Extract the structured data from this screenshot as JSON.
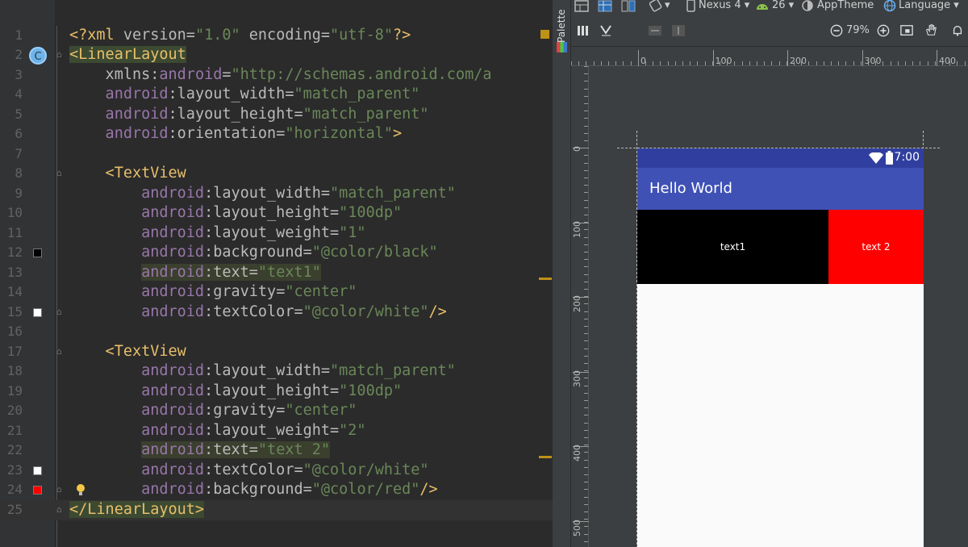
{
  "editor": {
    "lines": [
      {
        "n": "1",
        "segs": [
          [
            "g-tag",
            "<?xml "
          ],
          [
            "g-plain",
            "version"
          ],
          [
            "g-plain",
            "="
          ],
          [
            "g-str",
            "\"1.0\""
          ],
          [
            "g-plain",
            " encoding"
          ],
          [
            "g-plain",
            "="
          ],
          [
            "g-str",
            "\"utf-8\""
          ],
          [
            "g-tag",
            "?>"
          ]
        ]
      },
      {
        "n": "2",
        "segs": [
          [
            "g-tag g-hl2",
            "<LinearLayout"
          ]
        ]
      },
      {
        "n": "3",
        "segs": [
          [
            "g-plain",
            "    xmlns"
          ],
          [
            "g-plain",
            ":"
          ],
          [
            "g-attr",
            "android"
          ],
          [
            "g-plain",
            "="
          ],
          [
            "g-str",
            "\"http://schemas.android.com/a"
          ]
        ]
      },
      {
        "n": "4",
        "segs": [
          [
            "g-attr",
            "    android"
          ],
          [
            "g-plain",
            ":layout_width"
          ],
          [
            "g-plain",
            "="
          ],
          [
            "g-str",
            "\"match_parent\""
          ]
        ]
      },
      {
        "n": "5",
        "segs": [
          [
            "g-attr",
            "    android"
          ],
          [
            "g-plain",
            ":layout_height"
          ],
          [
            "g-plain",
            "="
          ],
          [
            "g-str",
            "\"match_parent\""
          ]
        ]
      },
      {
        "n": "6",
        "segs": [
          [
            "g-attr",
            "    android"
          ],
          [
            "g-plain",
            ":orientation"
          ],
          [
            "g-plain",
            "="
          ],
          [
            "g-str",
            "\"horizontal\""
          ],
          [
            "g-tag",
            ">"
          ]
        ]
      },
      {
        "n": "7",
        "segs": []
      },
      {
        "n": "8",
        "segs": [
          [
            "g-tag",
            "    <TextView"
          ]
        ]
      },
      {
        "n": "9",
        "segs": [
          [
            "g-attr",
            "        android"
          ],
          [
            "g-plain",
            ":layout_width"
          ],
          [
            "g-plain",
            "="
          ],
          [
            "g-str",
            "\"match_parent\""
          ]
        ]
      },
      {
        "n": "10",
        "segs": [
          [
            "g-attr",
            "        android"
          ],
          [
            "g-plain",
            ":layout_height"
          ],
          [
            "g-plain",
            "="
          ],
          [
            "g-str",
            "\"100dp\""
          ]
        ]
      },
      {
        "n": "11",
        "segs": [
          [
            "g-attr",
            "        android"
          ],
          [
            "g-plain",
            ":layout_weight"
          ],
          [
            "g-plain",
            "="
          ],
          [
            "g-str",
            "\"1\""
          ]
        ]
      },
      {
        "n": "12",
        "segs": [
          [
            "g-attr",
            "        android"
          ],
          [
            "g-plain",
            ":background"
          ],
          [
            "g-plain",
            "="
          ],
          [
            "g-str",
            "\"@color/black\""
          ]
        ]
      },
      {
        "n": "13",
        "segs": [
          [
            "g-plain",
            "        "
          ],
          [
            "g-attr g-hl",
            "android"
          ],
          [
            "g-plain g-hl",
            ":text"
          ],
          [
            "g-plain g-hl",
            "="
          ],
          [
            "g-str g-hl",
            "\"text1\""
          ]
        ]
      },
      {
        "n": "14",
        "segs": [
          [
            "g-attr",
            "        android"
          ],
          [
            "g-plain",
            ":gravity"
          ],
          [
            "g-plain",
            "="
          ],
          [
            "g-str",
            "\"center\""
          ]
        ]
      },
      {
        "n": "15",
        "segs": [
          [
            "g-attr",
            "        android"
          ],
          [
            "g-plain",
            ":textColor"
          ],
          [
            "g-plain",
            "="
          ],
          [
            "g-str",
            "\"@color/white\""
          ],
          [
            "g-tag",
            "/>"
          ]
        ]
      },
      {
        "n": "16",
        "segs": []
      },
      {
        "n": "17",
        "segs": [
          [
            "g-tag",
            "    <TextView"
          ]
        ]
      },
      {
        "n": "18",
        "segs": [
          [
            "g-attr",
            "        android"
          ],
          [
            "g-plain",
            ":layout_width"
          ],
          [
            "g-plain",
            "="
          ],
          [
            "g-str",
            "\"match_parent\""
          ]
        ]
      },
      {
        "n": "19",
        "segs": [
          [
            "g-attr",
            "        android"
          ],
          [
            "g-plain",
            ":layout_height"
          ],
          [
            "g-plain",
            "="
          ],
          [
            "g-str",
            "\"100dp\""
          ]
        ]
      },
      {
        "n": "20",
        "segs": [
          [
            "g-attr",
            "        android"
          ],
          [
            "g-plain",
            ":gravity"
          ],
          [
            "g-plain",
            "="
          ],
          [
            "g-str",
            "\"center\""
          ]
        ]
      },
      {
        "n": "21",
        "segs": [
          [
            "g-attr",
            "        android"
          ],
          [
            "g-plain",
            ":layout_weight"
          ],
          [
            "g-plain",
            "="
          ],
          [
            "g-str",
            "\"2\""
          ]
        ]
      },
      {
        "n": "22",
        "segs": [
          [
            "g-plain",
            "        "
          ],
          [
            "g-attr g-hl",
            "android"
          ],
          [
            "g-plain g-hl",
            ":text"
          ],
          [
            "g-plain g-hl",
            "="
          ],
          [
            "g-str g-hl",
            "\"text 2\""
          ]
        ]
      },
      {
        "n": "23",
        "segs": [
          [
            "g-attr",
            "        android"
          ],
          [
            "g-plain",
            ":textColor"
          ],
          [
            "g-plain",
            "="
          ],
          [
            "g-str",
            "\"@color/white\""
          ]
        ]
      },
      {
        "n": "24",
        "segs": [
          [
            "g-attr",
            "        android"
          ],
          [
            "g-plain",
            ":background"
          ],
          [
            "g-plain",
            "="
          ],
          [
            "g-str",
            "\"@color/red\""
          ],
          [
            "g-tag",
            "/>"
          ]
        ]
      },
      {
        "n": "25",
        "segs": [
          [
            "g-tag g-hl2",
            "</LinearLayout>"
          ]
        ]
      }
    ],
    "gutter_swatches": [
      {
        "line": "12",
        "color": "#000000"
      },
      {
        "line": "15",
        "color": "#ffffff"
      },
      {
        "line": "23",
        "color": "#ffffff"
      },
      {
        "line": "24",
        "color": "#ff0000"
      }
    ],
    "class_marker": "C"
  },
  "designer": {
    "palette_label": "Palette",
    "device": "Nexus 4",
    "api": "26",
    "theme": "AppTheme",
    "language": "Language",
    "zoom": "79%",
    "ruler_h": [
      "0",
      "100",
      "200",
      "300",
      "400"
    ],
    "ruler_v": [
      "0",
      "100",
      "200",
      "300",
      "400",
      "500"
    ],
    "preview": {
      "clock": "7:00",
      "app_title": "Hello World",
      "tv1_text": "text1",
      "tv2_text": "text 2",
      "status_color": "#303f9f",
      "appbar_color": "#3f51b5"
    }
  }
}
